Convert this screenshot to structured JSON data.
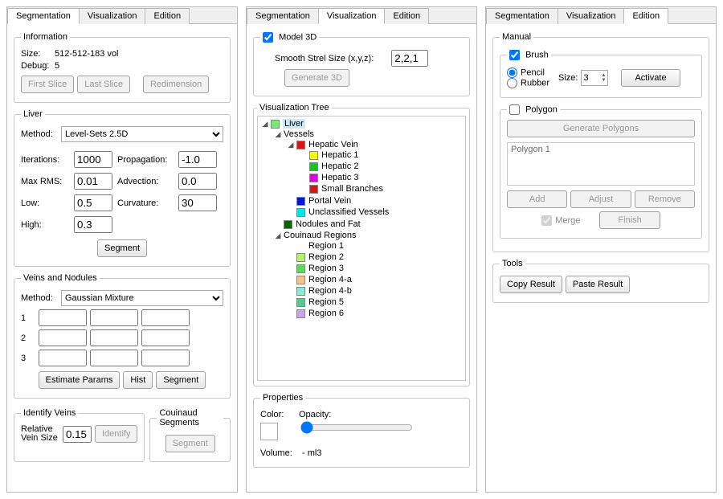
{
  "tabs": {
    "seg": "Segmentation",
    "vis": "Visualization",
    "edit": "Edition"
  },
  "seg": {
    "info": {
      "legend": "Information",
      "size_lbl": "Size:",
      "size_val": "512-512-183    vol",
      "debug_lbl": "Debug:",
      "debug_val": "5",
      "first": "First Slice",
      "last": "Last Slice",
      "redim": "Redimension"
    },
    "liver": {
      "legend": "Liver",
      "method_lbl": "Method:",
      "method_val": "Level-Sets 2.5D",
      "iter_lbl": "Iterations:",
      "iter_val": "1000",
      "prop_lbl": "Propagation:",
      "prop_val": "-1.0",
      "maxrms_lbl": "Max RMS:",
      "maxrms_val": "0.01",
      "adv_lbl": "Advection:",
      "adv_val": "0.0",
      "low_lbl": "Low:",
      "low_val": "0.5",
      "curv_lbl": "Curvature:",
      "curv_val": "30",
      "high_lbl": "High:",
      "high_val": "0.3",
      "segment": "Segment"
    },
    "vn": {
      "legend": "Veins and Nodules",
      "method_lbl": "Method:",
      "method_val": "Gaussian Mixture",
      "rows": [
        "1",
        "2",
        "3"
      ],
      "est": "Estimate Params",
      "hist": "Hist",
      "seg": "Segment"
    },
    "idv": {
      "legend": "Identify Veins",
      "rel_lbl": "Relative Vein Size",
      "rel_val": "0.15",
      "identify": "Identify"
    },
    "cou": {
      "legend": "Couinaud Segments",
      "segment": "Segment"
    }
  },
  "vis": {
    "model": {
      "legend": "Model 3D",
      "checked": true,
      "smooth_lbl": "Smooth Strel Size (x,y,z):",
      "smooth_val": "2,2,1",
      "gen": "Generate 3D"
    },
    "tree_legend": "Visualization Tree",
    "tree": {
      "liver": "Liver",
      "vessels": "Vessels",
      "hv": "Hepatic Vein",
      "h1": "Hepatic 1",
      "h2": "Hepatic 2",
      "h3": "Hepatic 3",
      "sb": "Small Branches",
      "pv": "Portal Vein",
      "uv": "Unclassified Vessels",
      "nf": "Nodules and Fat",
      "cr": "Couinaud Regions",
      "r1": "Region 1",
      "r2": "Region 2",
      "r3": "Region 3",
      "r4a": "Region 4-a",
      "r4b": "Region 4-b",
      "r5": "Region 5",
      "r6": "Region 6"
    },
    "props": {
      "legend": "Properties",
      "color_lbl": "Color:",
      "opac_lbl": "Opacity:",
      "vol_lbl": "Volume:",
      "vol_val": "- ml3"
    },
    "colors": {
      "liver": "#7fe57f",
      "hv": "#d11919",
      "h1": "#f9f900",
      "h2": "#17c41d",
      "h3": "#e200e2",
      "sb": "#d11919",
      "pv": "#0018d0",
      "uv": "#00e6e6",
      "nf": "#006600",
      "r2": "#b4f074",
      "r3": "#5fd85f",
      "r4a": "#f2c48a",
      "r4b": "#8fe8d2",
      "r5": "#57c98f",
      "r6": "#c9a3e6"
    }
  },
  "edit": {
    "manual_legend": "Manual",
    "brush": {
      "legend": "Brush",
      "checked": true,
      "pencil": "Pencil",
      "rubber": "Rubber",
      "size_lbl": "Size:",
      "size_val": "3",
      "activate": "Activate"
    },
    "poly": {
      "legend": "Polygon",
      "checked": false,
      "gen": "Generate Polygons",
      "item": "Polygon 1",
      "add": "Add",
      "adjust": "Adjust",
      "remove": "Remove",
      "merge": "Merge",
      "finish": "Finish"
    },
    "tools": {
      "legend": "Tools",
      "copy": "Copy Result",
      "paste": "Paste Result"
    }
  }
}
